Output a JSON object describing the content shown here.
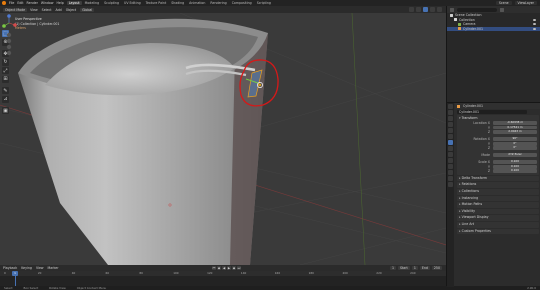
{
  "topbar": {
    "menus": [
      "File",
      "Edit",
      "Render",
      "Window",
      "Help"
    ],
    "workspaces": [
      "Layout",
      "Modeling",
      "Sculpting",
      "UV Editing",
      "Texture Paint",
      "Shading",
      "Animation",
      "Rendering",
      "Compositing",
      "Scripting"
    ],
    "active_workspace": "Layout",
    "scene": "Scene",
    "view_layer": "ViewLayer"
  },
  "viewport_header": {
    "mode": "Object Mode",
    "menus": [
      "View",
      "Select",
      "Add",
      "Object"
    ],
    "transform": "Global"
  },
  "viewport_info": {
    "view": "User Perspective",
    "collection": "(1) Collection | Cylinder.001",
    "note": "Meters"
  },
  "toolbar": {
    "tools": [
      {
        "icon": "select-box-icon",
        "active": true
      },
      {
        "icon": "cursor-icon",
        "active": false
      },
      {
        "icon": "move-icon",
        "active": false
      },
      {
        "icon": "rotate-icon",
        "active": false
      },
      {
        "icon": "scale-icon",
        "active": false
      },
      {
        "icon": "transform-icon",
        "active": false
      },
      {
        "icon": "annotate-icon",
        "active": false
      },
      {
        "icon": "measure-icon",
        "active": false
      },
      {
        "icon": "add-cube-icon",
        "active": false
      }
    ]
  },
  "timeline": {
    "menus": [
      "Playback",
      "Keying",
      "View",
      "Marker"
    ],
    "ticks": [
      "0",
      "20",
      "40",
      "60",
      "80",
      "100",
      "120",
      "140",
      "160",
      "180",
      "200",
      "220",
      "240"
    ],
    "current_frame": "1",
    "start_label": "Start",
    "start": "1",
    "end_label": "End",
    "end": "250"
  },
  "statusbar": {
    "items": [
      "Select",
      "Box Select",
      "Rotate View",
      "Object Context Menu"
    ],
    "version": "2.90.0"
  },
  "outliner": {
    "title": "Scene Collection",
    "rows": [
      {
        "label": "Scene Collection",
        "indent": 0,
        "icon_color": "#cfcfcf",
        "selected": false
      },
      {
        "label": "Collection",
        "indent": 1,
        "icon_color": "#d8d8d8",
        "selected": false
      },
      {
        "label": "Camera",
        "indent": 2,
        "icon_color": "#7fb24a",
        "selected": false
      },
      {
        "label": "Cylinder.001",
        "indent": 2,
        "icon_color": "#e99b45",
        "selected": true
      }
    ]
  },
  "properties": {
    "object_name": "Cylinder.001",
    "header": "Cylinder.001",
    "transform_title": "Transform",
    "location": {
      "label": "Location X",
      "x": "-0.60938 m",
      "y": "0.17541 m",
      "z": "2.0043 m"
    },
    "rotation": {
      "label": "Rotation X",
      "x": "90°",
      "y": "0°",
      "z": "0°"
    },
    "mode": {
      "label": "Mode",
      "value": "XYZ Euler"
    },
    "scale": {
      "label": "Scale X",
      "x": "0.100",
      "y": "0.100",
      "z": "0.100"
    },
    "collapsed": [
      "Delta Transform",
      "Relations",
      "Collections",
      "Instancing",
      "Motion Paths",
      "Visibility",
      "Viewport Display",
      "Line Art",
      "Custom Properties"
    ],
    "axis_labels": {
      "y": "Y",
      "z": "Z"
    }
  },
  "colors": {
    "accent": "#4772b3",
    "annotation": "#d41919",
    "brand": "#e87d0d"
  }
}
